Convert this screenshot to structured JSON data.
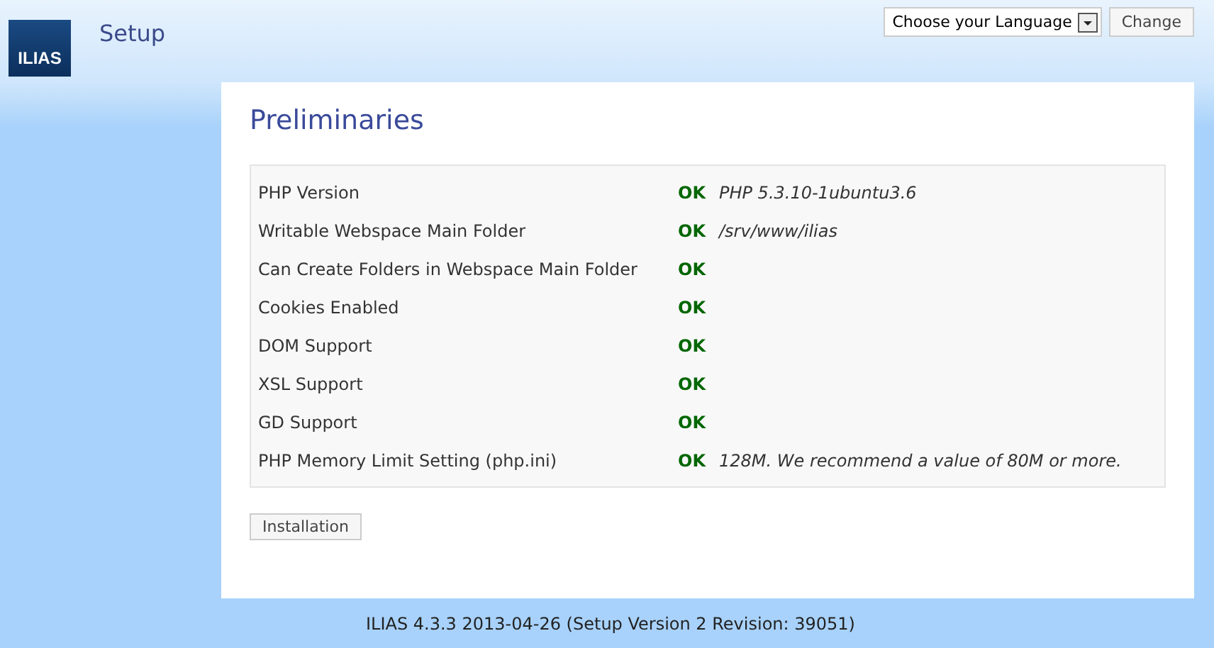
{
  "header": {
    "logo": "ILIAS",
    "title": "Setup",
    "language_select": {
      "value": "Choose your Language"
    },
    "change_button": "Change"
  },
  "panel": {
    "title": "Preliminaries",
    "checks": [
      {
        "label": "PHP Version",
        "status": "OK",
        "detail": "PHP 5.3.10-1ubuntu3.6"
      },
      {
        "label": "Writable Webspace Main Folder",
        "status": "OK",
        "detail": "/srv/www/ilias"
      },
      {
        "label": "Can Create Folders in Webspace Main Folder",
        "status": "OK"
      },
      {
        "label": "Cookies Enabled",
        "status": "OK"
      },
      {
        "label": "DOM Support",
        "status": "OK"
      },
      {
        "label": "XSL Support",
        "status": "OK"
      },
      {
        "label": "GD Support",
        "status": "OK"
      },
      {
        "label": "PHP Memory Limit Setting (php.ini)",
        "status": "OK",
        "detail": "128M. We recommend a value of 80M or more."
      }
    ],
    "button": "Installation"
  },
  "footer": "ILIAS 4.3.3 2013-04-26 (Setup Version 2 Revision: 39051)"
}
